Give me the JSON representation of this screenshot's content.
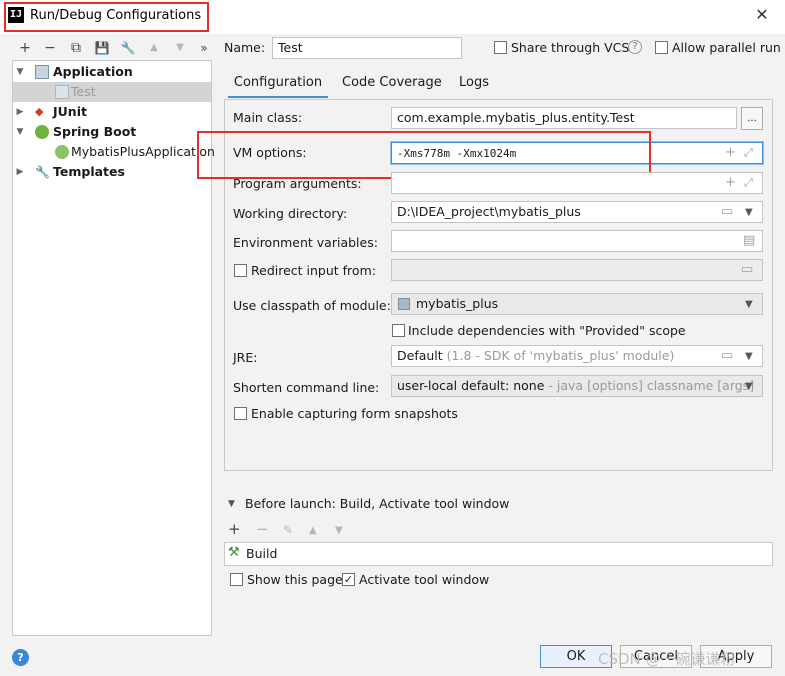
{
  "window": {
    "title": "Run/Debug Configurations",
    "close_glyph": "✕"
  },
  "toolbar": {
    "add": "+",
    "remove": "−",
    "copy": "⧉",
    "save": "💾",
    "wrench": "🔧",
    "up": "▲",
    "down": "▼",
    "more": "»"
  },
  "tree": {
    "items": [
      {
        "label": "Application",
        "icon": "application-icon"
      },
      {
        "label": "Test",
        "icon": "application-config-icon"
      },
      {
        "label": "JUnit",
        "icon": "junit-icon"
      },
      {
        "label": "Spring Boot",
        "icon": "spring-boot-icon"
      },
      {
        "label": "MybatisPlusApplication",
        "icon": "spring-boot-config-icon"
      },
      {
        "label": "Templates",
        "icon": "wrench-icon"
      }
    ]
  },
  "header": {
    "name_label": "Name:",
    "name_value": "Test",
    "share_label": "Share through VCS",
    "parallel_label": "Allow parallel run"
  },
  "tabs": [
    "Configuration",
    "Code Coverage",
    "Logs"
  ],
  "form": {
    "main_class_label": "Main class:",
    "main_class_value": "com.example.mybatis_plus.entity.Test",
    "browse": "...",
    "vm_label": "VM options:",
    "vm_value": "-Xms778m -Xmx1024m",
    "program_args_label": "Program arguments:",
    "working_dir_label": "Working directory:",
    "working_dir_value": "D:\\IDEA_project\\mybatis_plus",
    "env_label": "Environment variables:",
    "redirect_label": "Redirect input from:",
    "classpath_label": "Use classpath of module:",
    "classpath_value": "mybatis_plus",
    "include_deps_label": "Include dependencies with \"Provided\" scope",
    "jre_label": "JRE:",
    "jre_value": "Default",
    "jre_hint": "(1.8 - SDK of 'mybatis_plus' module)",
    "shorten_label": "Shorten command line:",
    "shorten_value": "user-local default: none",
    "shorten_hint": "- java [options] classname [args]",
    "snapshots_label": "Enable capturing form snapshots"
  },
  "before_launch": {
    "title": "Before launch: Build, Activate tool window",
    "tasks": [
      "Build"
    ],
    "show_page_label": "Show this page",
    "activate_label": "Activate tool window"
  },
  "buttons": {
    "ok": "OK",
    "cancel": "Cancel",
    "apply": "Apply"
  },
  "help": "?",
  "watermark": "CSDN @一碗谦谦粉",
  "colors": {
    "accent": "#3d8fd6",
    "highlight_box": "#e03030"
  }
}
